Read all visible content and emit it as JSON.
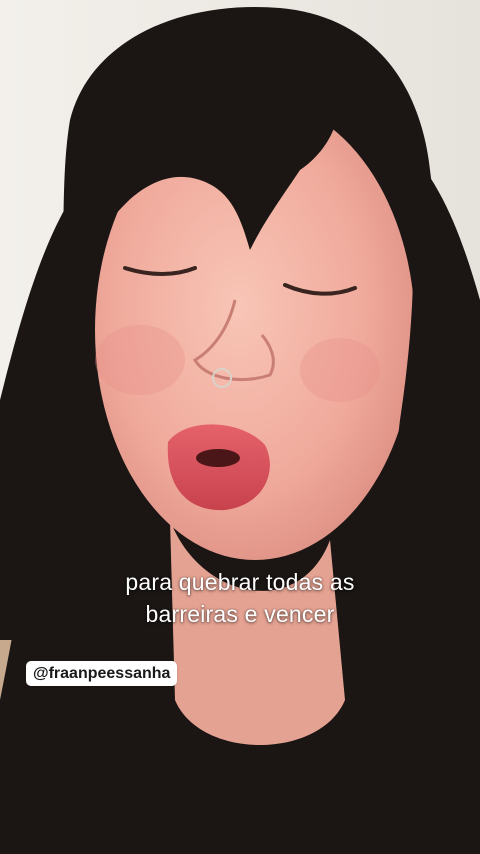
{
  "story": {
    "caption_lines": [
      "para quebrar todas as",
      "barreiras e vencer"
    ],
    "mention_tag": "@fraanpeessanha"
  },
  "colors": {
    "caption_text": "#ffffff",
    "mention_background": "#ffffff",
    "mention_text": "#1a1a1a",
    "hair": "#1b1614",
    "skin": "#f2b3a6",
    "wall": "#ece8e2",
    "lips": "#d9545d"
  }
}
